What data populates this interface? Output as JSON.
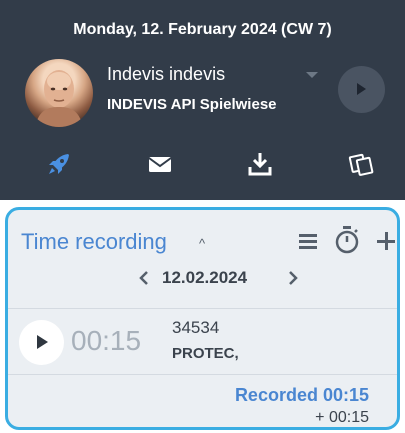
{
  "header": {
    "date_text": "Monday, 12. February 2024 (CW 7)",
    "user_name": "Indevis indevis",
    "org_name": "INDEVIS API Spielwiese",
    "nav_icons": [
      "rocket-icon",
      "mail-icon",
      "download-icon",
      "copy-icon"
    ],
    "accent_color": "#4a90e2",
    "background_color": "#323c49"
  },
  "time_recording": {
    "title": "Time recording",
    "current_date": "12.02.2024",
    "entries": [
      {
        "duration": "00:15",
        "id": "34534",
        "client": "PROTEC,"
      }
    ],
    "recorded_text": "Recorded 00:15",
    "added_text": "+ 00:15",
    "border_color": "#3aade2",
    "title_color": "#4a86d1"
  }
}
